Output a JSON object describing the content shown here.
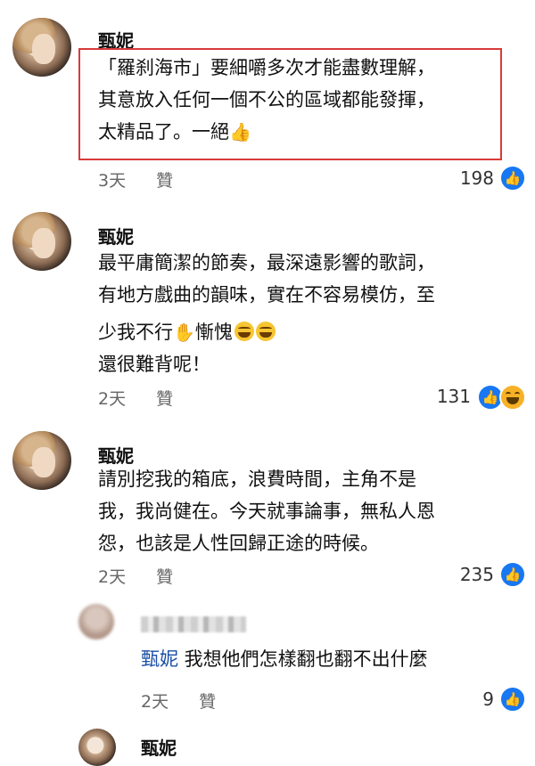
{
  "comments": [
    {
      "author": "甄妮",
      "lines": [
        "「羅刹海市」要細嚼多次才能盡數理解，",
        "其意放入任何一個不公的區域都能發揮，",
        "太精品了。一絕"
      ],
      "emoji": "👍",
      "time": "3天",
      "like_label": "贊",
      "likes": "198"
    },
    {
      "author": "甄妮",
      "lines": [
        "最平庸簡潔的節奏，最深遠影響的歌詞，",
        "有地方戲曲的韻味，實在不容易模仿，至",
        "少我不行",
        "還很難背呢！"
      ],
      "line3_suffix": "慚愧",
      "emoji": "✋",
      "time": "2天",
      "like_label": "贊",
      "likes": "131"
    },
    {
      "author": "甄妮",
      "lines": [
        "請別挖我的箱底，浪費時間，主角不是",
        "我，我尚健在。今天就事論事，無私人恩",
        "怨，也該是人性回歸正途的時候。"
      ],
      "time": "2天",
      "like_label": "贊",
      "likes": "235"
    }
  ],
  "reply": {
    "mention": "甄妮",
    "text": " 我想他們怎樣翻也翻不出什麼",
    "time": "2天",
    "like_label": "贊",
    "likes": "9"
  },
  "bottom": {
    "author": "甄妮"
  },
  "colors": {
    "like_blue": "#1877f2",
    "highlight_red": "#d83a3a",
    "mention_blue": "#1b4fa8"
  }
}
